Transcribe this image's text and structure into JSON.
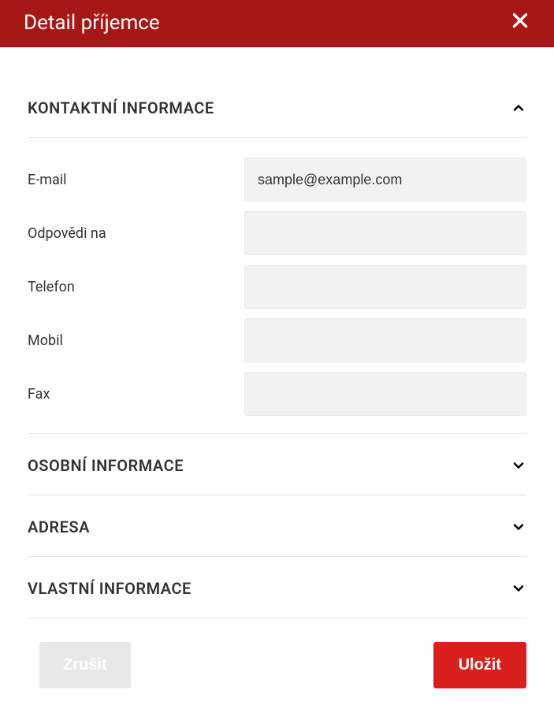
{
  "header": {
    "title": "Detail příjemce"
  },
  "sections": {
    "contact": {
      "title": "KONTAKTNÍ INFORMACE",
      "expanded": true,
      "fields": {
        "email": {
          "label": "E-mail",
          "value": "sample@example.com"
        },
        "reply_to": {
          "label": "Odpovědi na",
          "value": ""
        },
        "phone": {
          "label": "Telefon",
          "value": ""
        },
        "mobile": {
          "label": "Mobil",
          "value": ""
        },
        "fax": {
          "label": "Fax",
          "value": ""
        }
      }
    },
    "personal": {
      "title": "OSOBNÍ INFORMACE",
      "expanded": false
    },
    "address": {
      "title": "ADRESA",
      "expanded": false
    },
    "custom": {
      "title": "VLASTNÍ INFORMACE",
      "expanded": false
    }
  },
  "footer": {
    "cancel_label": "Zrušit",
    "save_label": "Uložit"
  }
}
